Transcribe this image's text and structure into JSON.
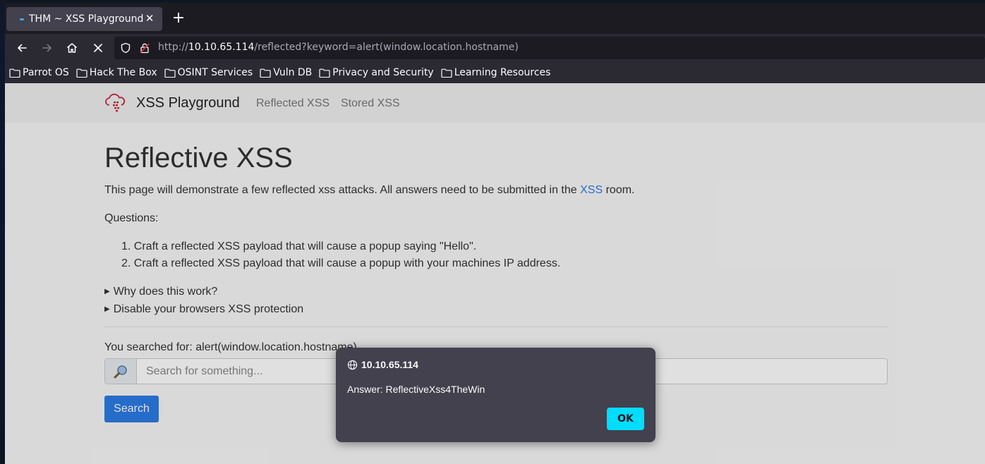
{
  "browser": {
    "tab_title": "THM ~ XSS Playground",
    "url_scheme": "http://",
    "url_host": "10.10.65.114",
    "url_path": "/reflected?keyword=alert(window.location.hostname)",
    "bookmarks": [
      "Parrot OS",
      "Hack The Box",
      "OSINT Services",
      "Vuln DB",
      "Privacy and Security",
      "Learning Resources"
    ]
  },
  "site": {
    "brand": "XSS Playground",
    "nav_links": [
      "Reflected XSS",
      "Stored XSS"
    ]
  },
  "content": {
    "heading": "Reflective XSS",
    "intro_before": "This page will demonstrate a few reflected xss attacks. All answers need to be submitted in the ",
    "intro_link": "XSS",
    "intro_after": " room.",
    "questions_label": "Questions:",
    "questions": [
      "Craft a reflected XSS payload that will cause a popup saying \"Hello\".",
      "Craft a reflected XSS payload that will cause a popup with your machines IP address."
    ],
    "details": [
      "Why does this work?",
      "Disable your browsers XSS protection"
    ],
    "searched_prefix": "You searched for: ",
    "searched_value": "alert(window.location.hostname)",
    "search_placeholder": "Search for something...",
    "search_button": "Search"
  },
  "alert": {
    "origin": "10.10.65.114",
    "message": "Answer: ReflectiveXss4TheWin",
    "ok_label": "OK"
  },
  "colors": {
    "accent": "#2c7be5",
    "dialog_bg": "#42414d",
    "ok_button": "#00ddff"
  }
}
